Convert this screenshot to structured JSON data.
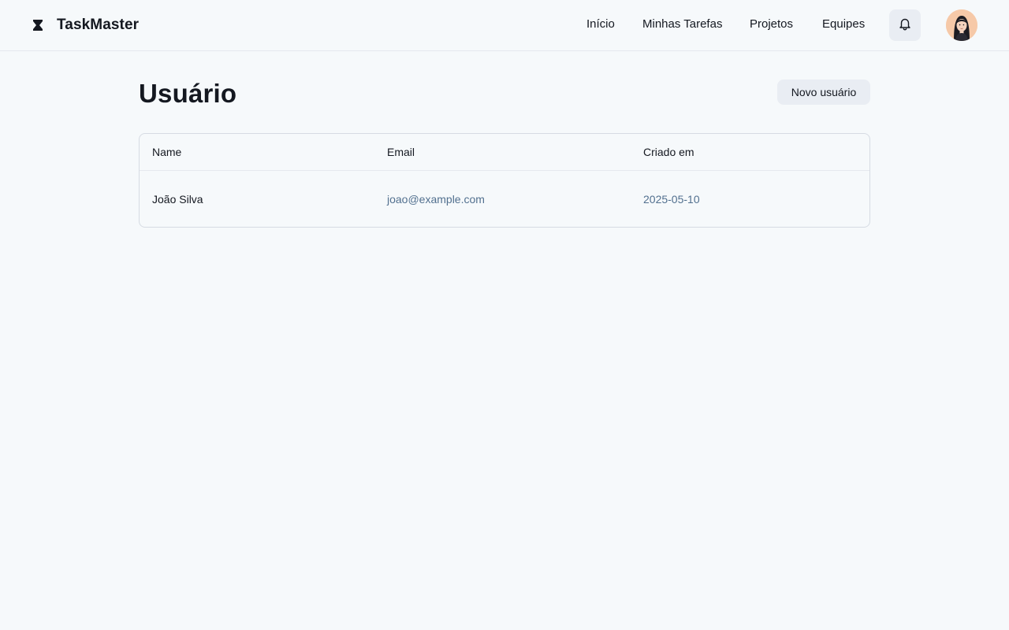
{
  "app": {
    "name": "TaskMaster",
    "logo_icon": "hourglass-logo-icon"
  },
  "nav": {
    "items": [
      {
        "label": "Início"
      },
      {
        "label": "Minhas Tarefas"
      },
      {
        "label": "Projetos"
      },
      {
        "label": "Equipes"
      }
    ],
    "notifications_icon": "bell-icon",
    "avatar": "user-avatar"
  },
  "page": {
    "title": "Usuário",
    "new_button_label": "Novo usuário"
  },
  "table": {
    "columns": [
      "Name",
      "Email",
      "Criado em"
    ],
    "rows": [
      {
        "name": "João Silva",
        "email": "joao@example.com",
        "created": "2025-05-10"
      }
    ]
  },
  "colors": {
    "background": "#f6f9fb",
    "text": "#141820",
    "muted_link": "#52708f",
    "button_bg": "#e9edf3",
    "border": "#d6dbe3"
  }
}
